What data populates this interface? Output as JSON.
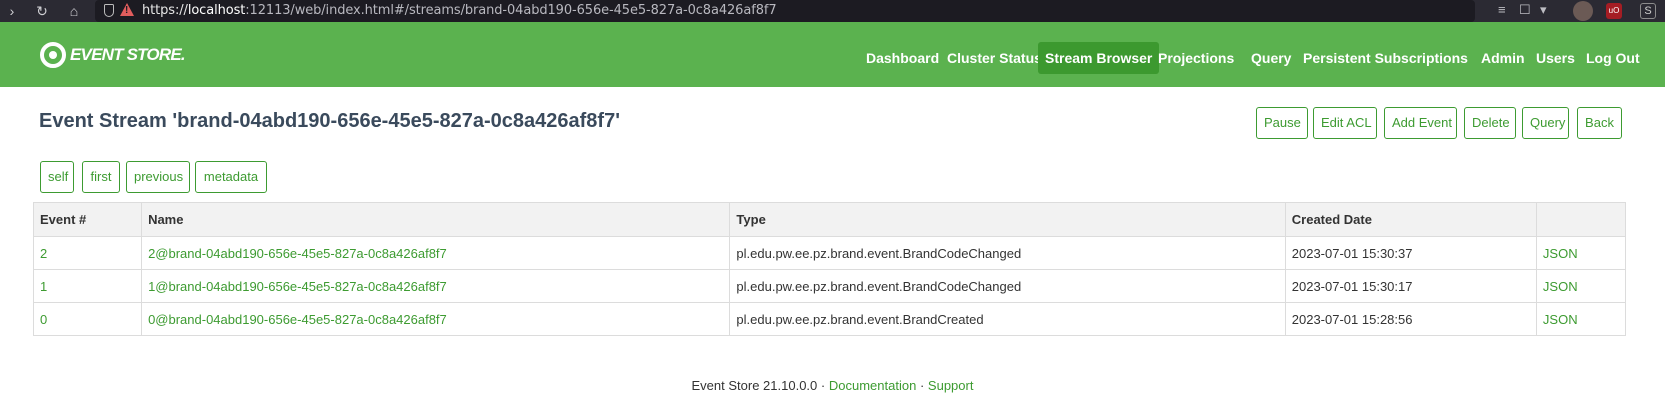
{
  "browser": {
    "url_scheme": "https://",
    "url_host": "localhost",
    "url_rest": ":12113/web/index.html#/streams/brand-04abd190-656e-45e5-827a-0c8a426af8f7"
  },
  "header": {
    "logo_text": "EVENT STORE.",
    "nav": [
      "Dashboard",
      "Cluster Status",
      "Stream Browser",
      "Projections",
      "Query",
      "Persistent Subscriptions",
      "Admin",
      "Users",
      "Log Out"
    ],
    "active_nav": "Stream Browser",
    "accent_color": "#5bb24f"
  },
  "page": {
    "title": "Event Stream 'brand-04abd190-656e-45e5-827a-0c8a426af8f7'",
    "actions": [
      "Pause",
      "Edit ACL",
      "Add Event",
      "Delete",
      "Query",
      "Back"
    ],
    "links": [
      "self",
      "first",
      "previous",
      "metadata"
    ]
  },
  "table": {
    "columns": [
      "Event #",
      "Name",
      "Type",
      "Created Date",
      ""
    ],
    "rows": [
      {
        "num": "2",
        "name": "2@brand-04abd190-656e-45e5-827a-0c8a426af8f7",
        "type": "pl.edu.pw.ee.pz.brand.event.BrandCodeChanged",
        "created": "2023-07-01 15:30:37",
        "json": "JSON"
      },
      {
        "num": "1",
        "name": "1@brand-04abd190-656e-45e5-827a-0c8a426af8f7",
        "type": "pl.edu.pw.ee.pz.brand.event.BrandCodeChanged",
        "created": "2023-07-01 15:30:17",
        "json": "JSON"
      },
      {
        "num": "0",
        "name": "0@brand-04abd190-656e-45e5-827a-0c8a426af8f7",
        "type": "pl.edu.pw.ee.pz.brand.event.BrandCreated",
        "created": "2023-07-01 15:28:56",
        "json": "JSON"
      }
    ]
  },
  "footer": {
    "version": "Event Store 21.10.0.0",
    "sep": "·",
    "documentation": "Documentation",
    "support": "Support"
  }
}
